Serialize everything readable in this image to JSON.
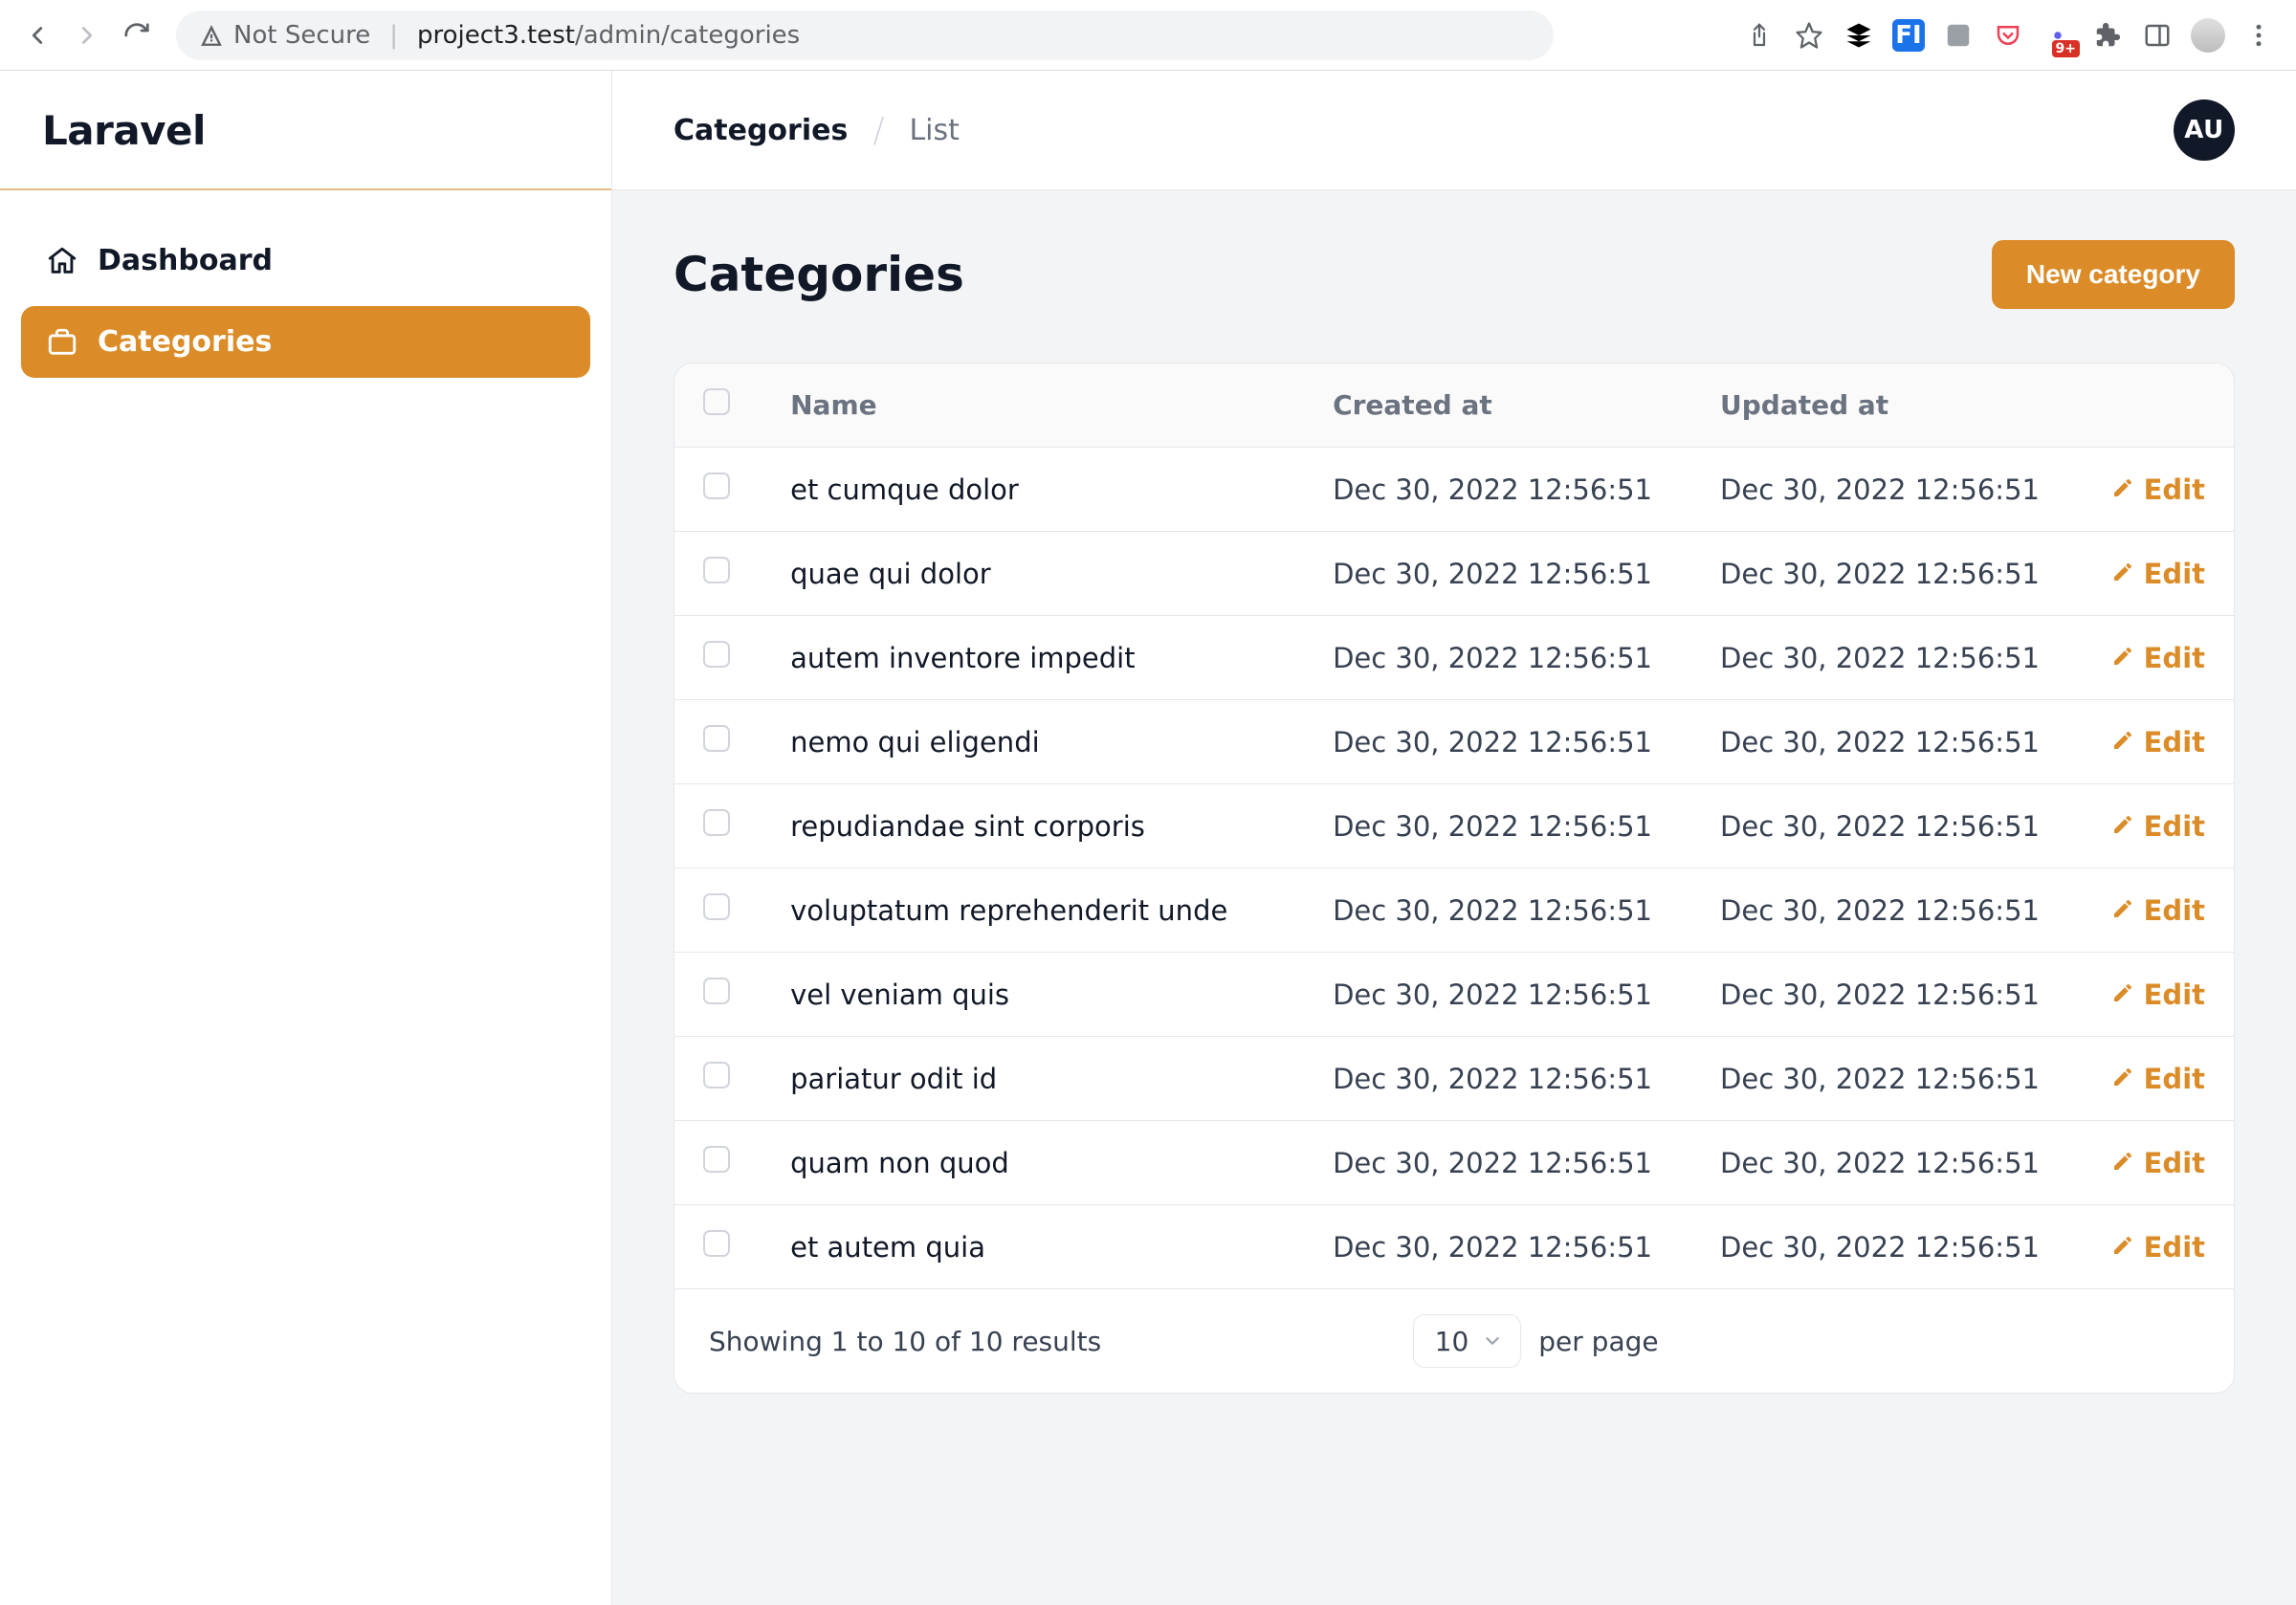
{
  "browser": {
    "not_secure": "Not Secure",
    "url_host": "project3.test",
    "url_path": "/admin/categories",
    "badge": "9+"
  },
  "app": {
    "logo": "Laravel",
    "user_initials": "AU"
  },
  "sidebar": {
    "items": [
      {
        "label": "Dashboard",
        "icon": "home",
        "active": false
      },
      {
        "label": "Categories",
        "icon": "briefcase",
        "active": true
      }
    ]
  },
  "breadcrumbs": {
    "root": "Categories",
    "leaf": "List"
  },
  "page": {
    "title": "Categories",
    "new_button": "New category"
  },
  "table": {
    "columns": {
      "name": "Name",
      "created": "Created at",
      "updated": "Updated at"
    },
    "edit_label": "Edit",
    "rows": [
      {
        "name": "et cumque dolor",
        "created": "Dec 30, 2022 12:56:51",
        "updated": "Dec 30, 2022 12:56:51"
      },
      {
        "name": "quae qui dolor",
        "created": "Dec 30, 2022 12:56:51",
        "updated": "Dec 30, 2022 12:56:51"
      },
      {
        "name": "autem inventore impedit",
        "created": "Dec 30, 2022 12:56:51",
        "updated": "Dec 30, 2022 12:56:51"
      },
      {
        "name": "nemo qui eligendi",
        "created": "Dec 30, 2022 12:56:51",
        "updated": "Dec 30, 2022 12:56:51"
      },
      {
        "name": "repudiandae sint corporis",
        "created": "Dec 30, 2022 12:56:51",
        "updated": "Dec 30, 2022 12:56:51"
      },
      {
        "name": "voluptatum reprehenderit unde",
        "created": "Dec 30, 2022 12:56:51",
        "updated": "Dec 30, 2022 12:56:51"
      },
      {
        "name": "vel veniam quis",
        "created": "Dec 30, 2022 12:56:51",
        "updated": "Dec 30, 2022 12:56:51"
      },
      {
        "name": "pariatur odit id",
        "created": "Dec 30, 2022 12:56:51",
        "updated": "Dec 30, 2022 12:56:51"
      },
      {
        "name": "quam non quod",
        "created": "Dec 30, 2022 12:56:51",
        "updated": "Dec 30, 2022 12:56:51"
      },
      {
        "name": "et autem quia",
        "created": "Dec 30, 2022 12:56:51",
        "updated": "Dec 30, 2022 12:56:51"
      }
    ],
    "footer": {
      "summary": "Showing 1 to 10 of 10 results",
      "per_page_value": "10",
      "per_page_label": "per page"
    }
  }
}
